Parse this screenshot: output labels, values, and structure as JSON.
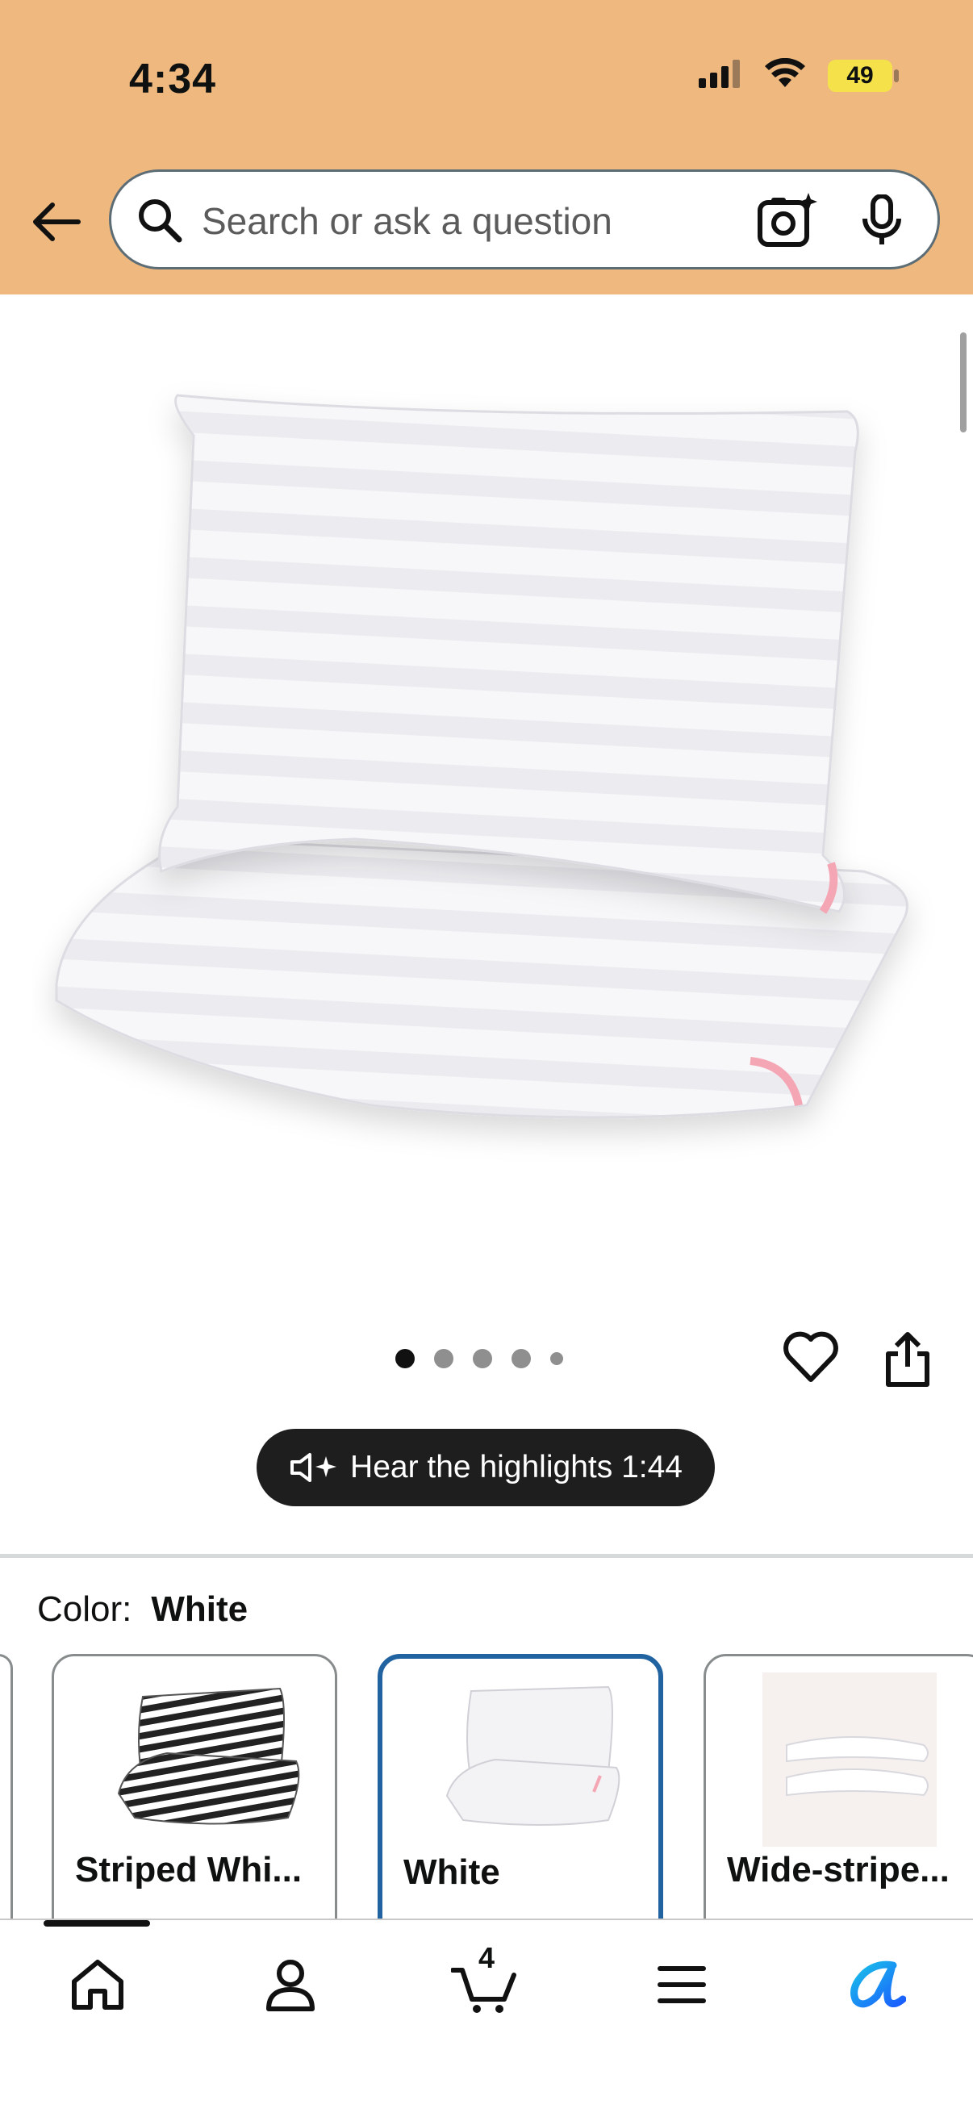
{
  "status_bar": {
    "time": "4:34",
    "battery": "49"
  },
  "search": {
    "placeholder": "Search or ask a question"
  },
  "carousel": {
    "dots": 5,
    "active_index": 0
  },
  "audio_button": {
    "label": "Hear the highlights 1:44"
  },
  "color_selector": {
    "label": "Color:",
    "selected": "White",
    "options": [
      {
        "label": "Striped Whi...",
        "selected": false
      },
      {
        "label": "White",
        "selected": true
      },
      {
        "label": "Wide-stripe...",
        "selected": false
      }
    ]
  },
  "tab_bar": {
    "cart_count": "4"
  },
  "colors": {
    "header_bg": "#eeb87e",
    "selected_border": "#2162a1",
    "alexa_blue": "#1a8cff"
  }
}
